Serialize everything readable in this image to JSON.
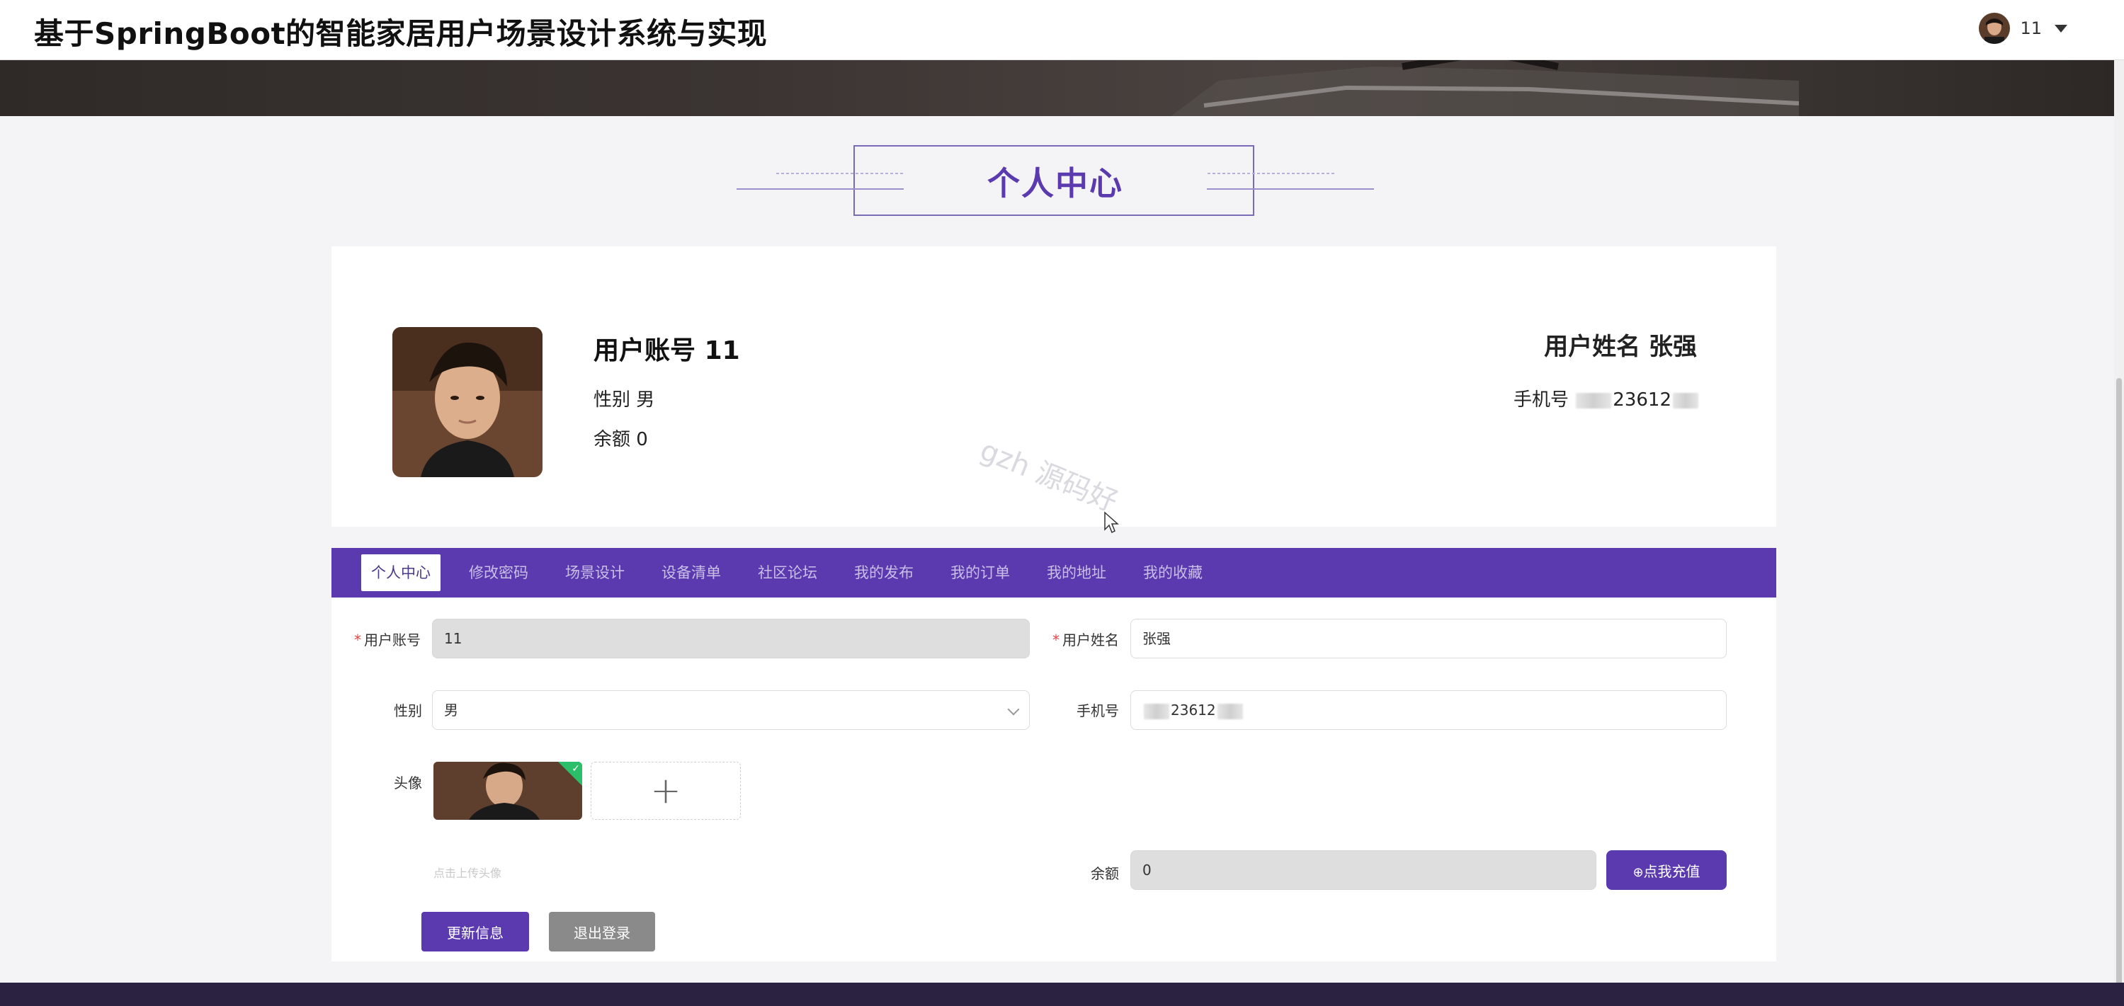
{
  "header": {
    "site_title": "基于SpringBoot的智能家居用户场景设计系统与实现",
    "user_name": "11"
  },
  "section": {
    "title": "个人中心"
  },
  "profile": {
    "account_label": "用户账号",
    "account_value": "11",
    "gender_label": "性别",
    "gender_value": "男",
    "balance_label": "余额",
    "balance_value": "0",
    "name_label": "用户姓名",
    "name_value": "张强",
    "phone_label": "手机号",
    "phone_visible_digits": "23612"
  },
  "tabs": [
    {
      "label": "个人中心",
      "active": true
    },
    {
      "label": "修改密码"
    },
    {
      "label": "场景设计"
    },
    {
      "label": "设备清单"
    },
    {
      "label": "社区论坛"
    },
    {
      "label": "我的发布"
    },
    {
      "label": "我的订单"
    },
    {
      "label": "我的地址"
    },
    {
      "label": "我的收藏"
    }
  ],
  "form": {
    "account_label": "用户账号",
    "account_value": "11",
    "name_label": "用户姓名",
    "name_value": "张强",
    "gender_label": "性别",
    "gender_value": "男",
    "phone_label": "手机号",
    "phone_value": "23612",
    "avatar_label": "头像",
    "upload_hint": "点击上传头像",
    "balance_label": "余额",
    "balance_value": "0",
    "recharge_label": "点我充值",
    "update_label": "更新信息",
    "logout_label": "退出登录"
  },
  "watermark": "gzh 源码好",
  "colors": {
    "accent": "#5b3ab0",
    "success": "#2bbf6a",
    "required": "#e64545",
    "footer": "#2a2240"
  }
}
